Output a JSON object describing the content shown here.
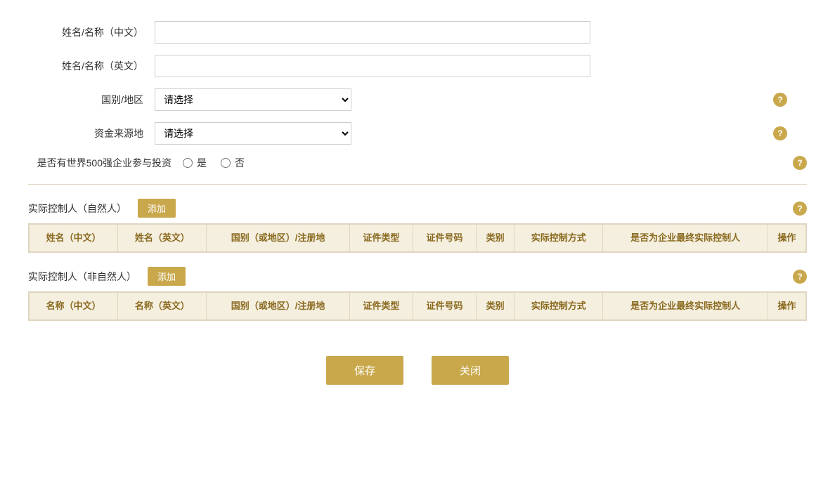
{
  "form": {
    "name_cn_label": "姓名/名称（中文）",
    "name_en_label": "姓名/名称（英文）",
    "country_label": "国别/地区",
    "fund_source_label": "资金来源地",
    "fortune500_label": "是否有世界500强企业参与投资",
    "select_placeholder": "请选择",
    "radio_yes": "是",
    "radio_no": "否",
    "name_cn_value": "",
    "name_en_value": ""
  },
  "section_natural": {
    "title": "实际控制人（自然人）",
    "add_btn": "添加",
    "columns": [
      "姓名（中文）",
      "姓名（英文）",
      "国别（或地区）/注册地",
      "证件类型",
      "证件号码",
      "类别",
      "实际控制方式",
      "是否为企业最终实际控制人",
      "操作"
    ]
  },
  "section_non_natural": {
    "title": "实际控制人（非自然人）",
    "add_btn": "添加",
    "columns": [
      "名称（中文）",
      "名称（英文）",
      "国别（或地区）/注册地",
      "证件类型",
      "证件号码",
      "类别",
      "实际控制方式",
      "是否为企业最终实际控制人",
      "操作"
    ]
  },
  "footer": {
    "save_label": "保存",
    "close_label": "关闭"
  },
  "icons": {
    "help": "?"
  }
}
